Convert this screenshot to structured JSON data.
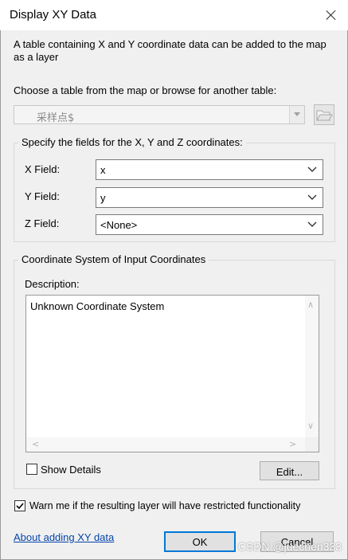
{
  "window": {
    "title": "Display XY Data"
  },
  "intro": "A table containing X and Y coordinate data can be added to the map as a layer",
  "choose_label": "Choose a table from the map or browse for another table:",
  "table_select": {
    "value": "采样点$"
  },
  "fields_group": {
    "legend": "Specify the fields for the X, Y and Z coordinates:",
    "x_label": "X Field:",
    "x_value": "x",
    "y_label": "Y Field:",
    "y_value": "y",
    "z_label": "Z Field:",
    "z_value": "<None>"
  },
  "coord_group": {
    "legend": "Coordinate System of Input Coordinates",
    "description_label": "Description:",
    "description_text": "Unknown Coordinate System",
    "show_details_label": "Show Details",
    "show_details_checked": false,
    "edit_label": "Edit..."
  },
  "warn": {
    "checked": true,
    "label": "Warn me if the resulting layer will have restricted functionality"
  },
  "about_link": "About adding XY data",
  "ok_label": "OK",
  "cancel_label": "Cancel",
  "watermark": "CSDN @juechen333"
}
